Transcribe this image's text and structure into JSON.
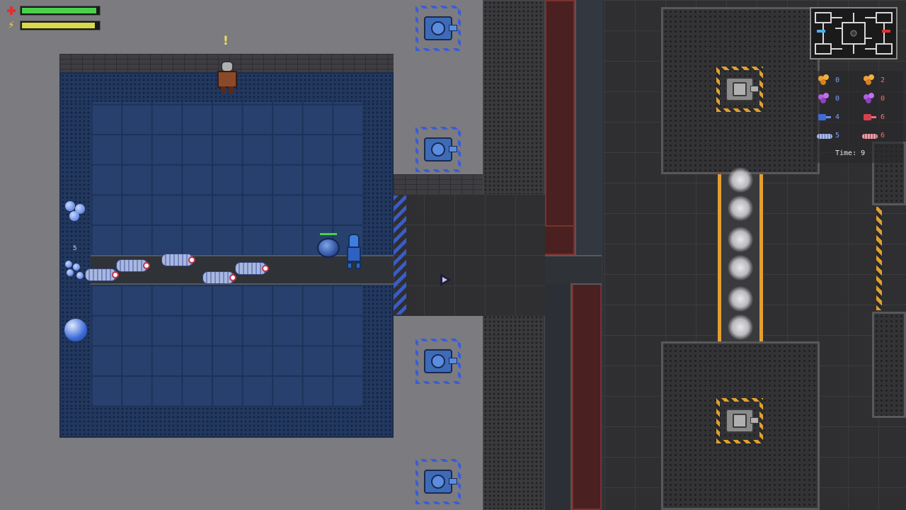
{
  "hud": {
    "health_fraction": 0.97,
    "energy_fraction": 0.95,
    "health_color": "#4ad04a",
    "energy_color": "#d8d84a",
    "health_icon": "red-cross-icon",
    "energy_icon": "lightning-icon"
  },
  "npc": {
    "alert": "!"
  },
  "room": {
    "counter": "5"
  },
  "counters": {
    "left": [
      {
        "icon": "orange-cells-icon",
        "value": "0"
      },
      {
        "icon": "purple-cells-icon",
        "value": "0"
      },
      {
        "icon": "blue-turret-icon",
        "value": "4"
      },
      {
        "icon": "blue-worm-icon",
        "value": "5"
      }
    ],
    "right": [
      {
        "icon": "orange-cells-icon",
        "value": "2"
      },
      {
        "icon": "purple-cells-icon",
        "value": "0"
      },
      {
        "icon": "red-turret-icon",
        "value": "6"
      },
      {
        "icon": "red-worm-icon",
        "value": "6"
      }
    ]
  },
  "timer": {
    "text": "Time: 9"
  },
  "colors": {
    "team_blue": "#3e6bb8",
    "team_red": "#d84050",
    "hazard_orange": "#e0a030"
  }
}
